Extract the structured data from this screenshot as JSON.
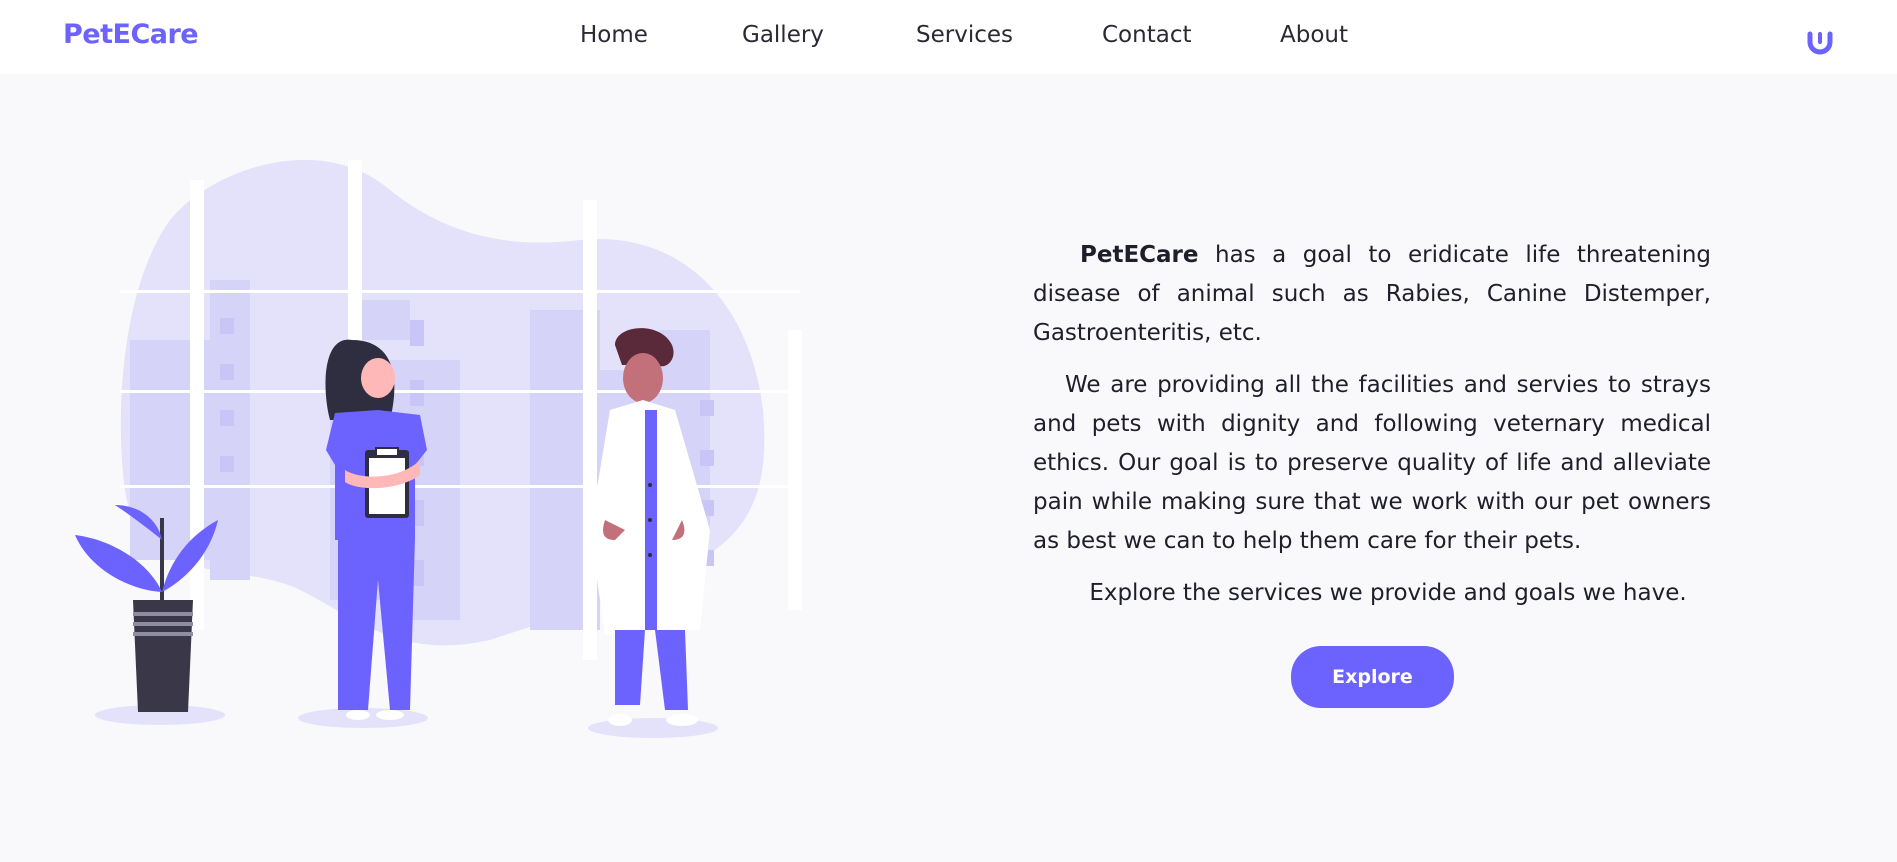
{
  "brand": {
    "name": "PetECare",
    "color": "#6c63ff"
  },
  "nav": {
    "items": [
      {
        "label": "Home"
      },
      {
        "label": "Gallery"
      },
      {
        "label": "Services"
      },
      {
        "label": "Contact"
      },
      {
        "label": "About"
      }
    ],
    "profile_icon": "smile-icon"
  },
  "hero": {
    "illustration": "doctors-illustration",
    "para1_brand": "PetECare",
    "para1_rest": " has a goal to eridicate life threatening disease of animal such as Rabies, Canine Distemper, Gastroenteritis, etc.",
    "para2": "We are providing all the facilities and servies to strays and pets with dignity and following veternary medical ethics. Our goal is to preserve quality of life and alleviate pain while making sure that we work with our pet owners as best we can to help them care for their pets.",
    "para3": "Explore the services we provide and goals we have.",
    "button_label": "Explore"
  },
  "colors": {
    "accent": "#6c63ff",
    "background": "#f9f9fb",
    "navbar": "#ffffff",
    "blob": "#e4e2fb",
    "text": "#1f1f2b"
  }
}
